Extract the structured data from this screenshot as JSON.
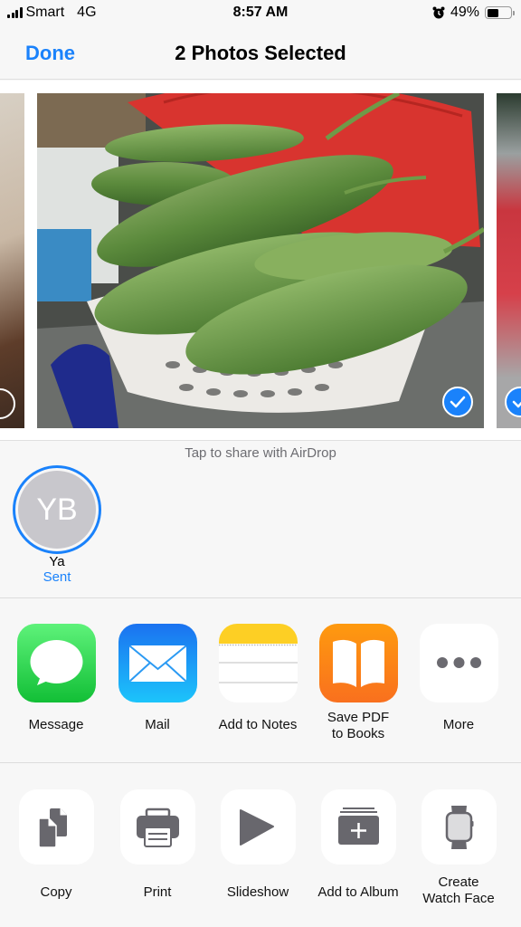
{
  "status_bar": {
    "carrier": "Smart",
    "network": "4G",
    "time": "8:57 AM",
    "battery_percent": "49%",
    "battery_level": 0.49,
    "alarm_icon": "alarm-clock-icon"
  },
  "nav": {
    "done_label": "Done",
    "title": "2 Photos Selected"
  },
  "photos": [
    {
      "name": "photo-previous",
      "selected": false
    },
    {
      "name": "photo-sponge-gourds-in-basket",
      "selected": true
    },
    {
      "name": "photo-next",
      "selected": true
    }
  ],
  "airdrop": {
    "hint": "Tap to share with AirDrop",
    "people": [
      {
        "initials": "YB",
        "name": "Ya",
        "status": "Sent"
      }
    ]
  },
  "apps": [
    {
      "label": "Message",
      "icon": "message-icon"
    },
    {
      "label": "Mail",
      "icon": "mail-icon"
    },
    {
      "label": "Add to Notes",
      "icon": "notes-icon"
    },
    {
      "label": "Save PDF",
      "label2": "to Books",
      "icon": "books-icon"
    },
    {
      "label": "More",
      "icon": "more-icon"
    }
  ],
  "actions": [
    {
      "label": "Copy",
      "icon": "copy-icon"
    },
    {
      "label": "Print",
      "icon": "print-icon"
    },
    {
      "label": "Slideshow",
      "icon": "slideshow-icon"
    },
    {
      "label": "Add to Album",
      "icon": "add-to-album-icon"
    },
    {
      "label": "Create",
      "label2": "Watch Face",
      "icon": "watch-icon"
    }
  ],
  "colors": {
    "accent": "#1a82fb",
    "message_green": "#2ecc52",
    "mail_blue": "#1f8cf5",
    "books_orange": "#fb8a14",
    "notes_yellow": "#fdd22a",
    "action_gray": "#68676d"
  }
}
